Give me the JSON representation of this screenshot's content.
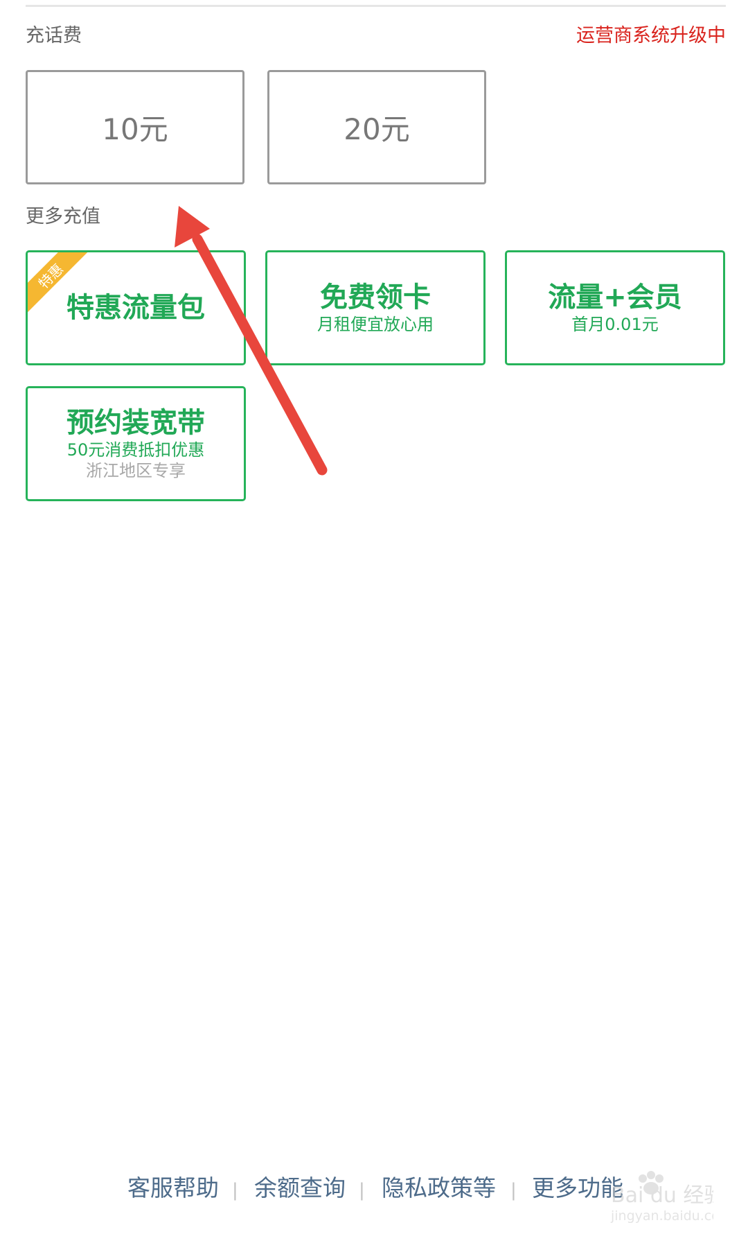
{
  "recharge": {
    "section_label": "充话费",
    "status": "运营商系统升级中",
    "amounts": [
      "10元",
      "20元"
    ]
  },
  "more": {
    "section_label": "更多充值",
    "cards": [
      {
        "title": "特惠流量包",
        "badge": "特惠"
      },
      {
        "title": "免费领卡",
        "subtitle": "月租便宜放心用"
      },
      {
        "title": "流量+会员",
        "subtitle": "首月0.01元"
      },
      {
        "title": "预约装宽带",
        "subtitle": "50元消费抵扣优惠",
        "note": "浙江地区专享"
      }
    ]
  },
  "footer": {
    "links": [
      "客服帮助",
      "余额查询",
      "隐私政策等",
      "更多功能"
    ],
    "separator": "|"
  },
  "watermark": {
    "brand": "Bai du 经验",
    "url": "jingyan.baidu.com"
  },
  "colors": {
    "accent_green": "#21a856",
    "status_red": "#d9231d",
    "badge_yellow": "#f5b731",
    "annotation_arrow": "#e8463c",
    "link_blue": "#4d6b8a"
  }
}
